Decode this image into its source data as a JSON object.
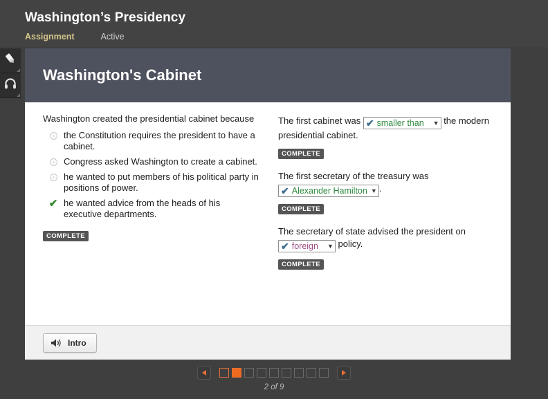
{
  "header": {
    "title": "Washington’s Presidency",
    "nav": {
      "assignment_label": "Assignment",
      "status_label": "Active"
    }
  },
  "tool_rail": {
    "items": [
      {
        "icon": "highlighter-icon",
        "label": "Highlighter"
      },
      {
        "icon": "headphones-icon",
        "label": "Audio"
      }
    ]
  },
  "stage": {
    "banner_title": "Washington's Cabinet",
    "left_column": {
      "question_stem": "Washington created the presidential cabinet because",
      "choices": [
        {
          "mark": "radio",
          "text": "the Constitution requires the president to have a cabinet."
        },
        {
          "mark": "radio",
          "text": "Congress asked Washington to create a cabinet."
        },
        {
          "mark": "radio",
          "text": "he wanted to put members of his political party in positions of power."
        },
        {
          "mark": "check",
          "text": "he wanted advice from the heads of his executive departments."
        }
      ],
      "status_badge": "COMPLETE"
    },
    "right_column": {
      "items": [
        {
          "text_before": "The first cabinet was ",
          "select_value": "smaller than",
          "select_color": "green",
          "text_after": " the modern presidential cabinet.",
          "status_badge": "COMPLETE"
        },
        {
          "text_before": "The first secretary of the treasury was ",
          "select_value": "Alexander Hamilton",
          "select_color": "green",
          "text_after": ".",
          "status_badge": "COMPLETE"
        },
        {
          "text_before": "The secretary of state advised the president on ",
          "select_value": "foreign",
          "select_color": "purple",
          "text_after": " policy.",
          "status_badge": "COMPLETE"
        }
      ]
    },
    "footer": {
      "audio_button_label": "Intro",
      "audio_button_icon": "speaker-icon"
    }
  },
  "pager": {
    "prev_icon": "triangle-left-icon",
    "next_icon": "triangle-right-icon",
    "total_pages": 9,
    "current_page": 2,
    "visited_pages": [
      1
    ],
    "count_label": "2 of 9"
  },
  "colors": {
    "accent_orange": "#ee6a1f",
    "nav_highlight": "#d3c48a",
    "correct_green": "#2f8a3e",
    "select_purple": "#9c4f86",
    "banner_slate": "#4e525e",
    "chrome_dark": "#3f3f3f"
  }
}
